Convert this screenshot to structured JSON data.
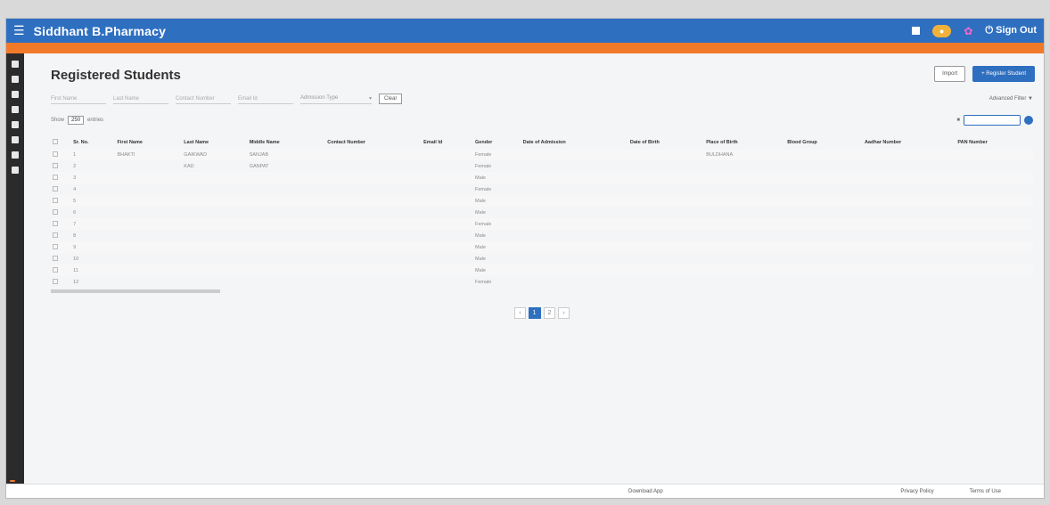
{
  "app": {
    "title": "Siddhant B.Pharmacy",
    "signout_label": "Sign Out"
  },
  "announcement": "",
  "page": {
    "title": "Registered Students",
    "import_label": "Import",
    "register_label": "+ Register Student"
  },
  "filters": {
    "first_name_placeholder": "First Name",
    "last_name_placeholder": "Last Name",
    "contact_placeholder": "Contact Number",
    "email_placeholder": "Email Id",
    "admission_type_placeholder": "Admission Type",
    "clear_label": "Clear",
    "advanced_label": "Advanced Filter"
  },
  "list": {
    "show_label": "Show",
    "entries_value": "250",
    "entries_label": "entries",
    "search_placeholder": ""
  },
  "table": {
    "columns": [
      "Sr. No.",
      "First Name",
      "Last Name",
      "Middle Name",
      "Contact Number",
      "Email Id",
      "Gender",
      "Date of Admission",
      "Date of Birth",
      "Place of Birth",
      "Blood Group",
      "Aadhar Number",
      "PAN Number"
    ],
    "rows": [
      [
        "1",
        "BHAKTI",
        "GAIKWAD",
        "SANJAB",
        "",
        "",
        "Female",
        "",
        "",
        "BULDHANA",
        "",
        "",
        ""
      ],
      [
        "2",
        "",
        "KAD",
        "GANPAT",
        "",
        "",
        "Female",
        "",
        "",
        "",
        "",
        "",
        ""
      ],
      [
        "3",
        "",
        "",
        "",
        "",
        "",
        "Male",
        "",
        "",
        "",
        "",
        "",
        ""
      ],
      [
        "4",
        "",
        "",
        "",
        "",
        "",
        "Female",
        "",
        "",
        "",
        "",
        "",
        ""
      ],
      [
        "5",
        "",
        "",
        "",
        "",
        "",
        "Male",
        "",
        "",
        "",
        "",
        "",
        ""
      ],
      [
        "6",
        "",
        "",
        "",
        "",
        "",
        "Male",
        "",
        "",
        "",
        "",
        "",
        ""
      ],
      [
        "7",
        "",
        "",
        "",
        "",
        "",
        "Female",
        "",
        "",
        "",
        "",
        "",
        ""
      ],
      [
        "8",
        "",
        "",
        "",
        "",
        "",
        "Male",
        "",
        "",
        "",
        "",
        "",
        ""
      ],
      [
        "9",
        "",
        "",
        "",
        "",
        "",
        "Male",
        "",
        "",
        "",
        "",
        "",
        ""
      ],
      [
        "10",
        "",
        "",
        "",
        "",
        "",
        "Male",
        "",
        "",
        "",
        "",
        "",
        ""
      ],
      [
        "11",
        "",
        "",
        "",
        "",
        "",
        "Male",
        "",
        "",
        "",
        "",
        "",
        ""
      ],
      [
        "12",
        "",
        "",
        "",
        "",
        "",
        "Female",
        "",
        "",
        "",
        "",
        "",
        ""
      ]
    ]
  },
  "pagination": {
    "pages": [
      "1",
      "2"
    ],
    "current": "1"
  },
  "footer": {
    "download_label": "Download App",
    "privacy_label": "Privacy Policy",
    "terms_label": "Terms of Use",
    "powered_label": ""
  },
  "colors": {
    "primary": "#2f6fc0",
    "announce": "#f07a2a",
    "sidebar": "#2b2b2b"
  }
}
